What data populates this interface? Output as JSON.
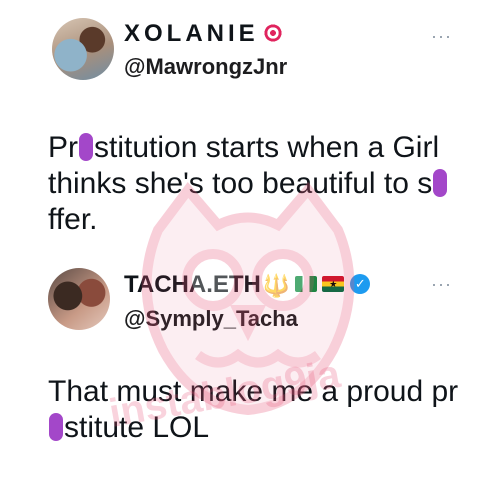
{
  "tweets": [
    {
      "display_name": "XOLANIE",
      "name_emojis": [
        "target-icon"
      ],
      "handle": "@MawrongzJnr",
      "more": "···",
      "text_segments": [
        "Pr",
        "stitution starts when a Girl thinks she's too beautiful to s",
        "ffer."
      ]
    },
    {
      "display_name": "TACHA.ETH",
      "name_emojis": [
        "trident-icon",
        "nigeria-flag-icon",
        "ghana-flag-icon",
        "verified-icon"
      ],
      "trident": "🔱",
      "verified": "✓",
      "handle": "@Symply_Tacha",
      "more": "···",
      "text_segments": [
        "That must make me a proud pr",
        "stitute LOL"
      ]
    }
  ],
  "watermark": {
    "text": "instablog9ja",
    "icon": "owl-logo-icon",
    "color": "#e8557a"
  },
  "colors": {
    "censor": "#a347c9",
    "verified": "#1d9bf0",
    "text": "#0f1419",
    "muted": "#8b98a5"
  }
}
